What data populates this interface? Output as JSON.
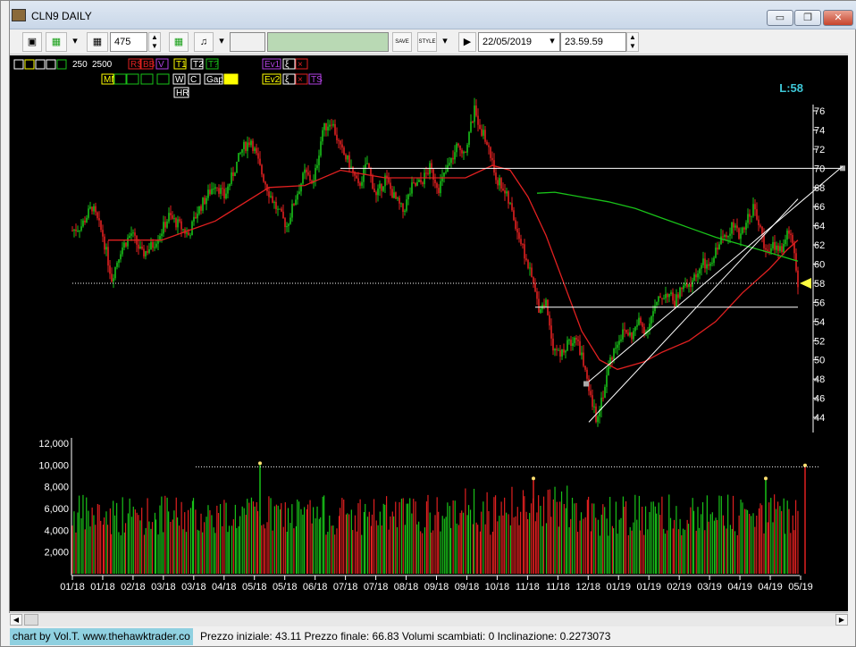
{
  "window": {
    "title": "CLN9 DAILY",
    "minimize_label": "▭",
    "restore_label": "❐",
    "close_label": "✕"
  },
  "toolbar": {
    "bars_value": "475",
    "date_value": "22/05/2019",
    "time_value": "23.59.59",
    "save_label": "SAVE",
    "style_label": "STYLE"
  },
  "indicator_bar": {
    "row1": [
      "250",
      "2500",
      "RS",
      "BB",
      "V",
      "T1",
      "T2",
      "T?",
      "Ev1",
      "ξ",
      "×"
    ],
    "row2": [
      "MM",
      "W",
      "C",
      "Gap",
      "Ev2",
      "ξ",
      "×",
      "TS"
    ],
    "row3": [
      "HR"
    ]
  },
  "last_label": "L:58",
  "colors": {
    "up": "#19c219",
    "down": "#e02020",
    "ma_fast": "#e02020",
    "ma_slow": "#19c219",
    "bg": "#000000",
    "credit_bg": "#8fd0e0"
  },
  "chart_data": {
    "type": "candlestick",
    "price_axis": {
      "ticks": [
        44,
        46,
        48,
        50,
        52,
        54,
        56,
        58,
        60,
        62,
        64,
        66,
        68,
        70,
        72,
        74,
        76
      ],
      "ylim": [
        43,
        77
      ]
    },
    "volume_axis": {
      "ticks": [
        "2,000",
        "4,000",
        "6,000",
        "8,000",
        "10,000",
        "12,000"
      ],
      "ylim": [
        0,
        12000
      ]
    },
    "x_labels": [
      "01/18",
      "01/18",
      "02/18",
      "03/18",
      "03/18",
      "04/18",
      "05/18",
      "05/18",
      "06/18",
      "07/18",
      "07/18",
      "08/18",
      "09/18",
      "09/18",
      "10/18",
      "11/18",
      "11/18",
      "12/18",
      "01/19",
      "01/19",
      "02/19",
      "03/19",
      "04/19",
      "04/19",
      "05/19"
    ],
    "close_path": [
      [
        0,
        63.5
      ],
      [
        10,
        64.0
      ],
      [
        22,
        66.0
      ],
      [
        34,
        63.0
      ],
      [
        44,
        58.5
      ],
      [
        54,
        61.5
      ],
      [
        66,
        63.2
      ],
      [
        78,
        61.0
      ],
      [
        90,
        62.0
      ],
      [
        100,
        63.5
      ],
      [
        108,
        65.0
      ],
      [
        120,
        64.0
      ],
      [
        130,
        63.0
      ],
      [
        140,
        65.5
      ],
      [
        150,
        67.0
      ],
      [
        160,
        68.5
      ],
      [
        170,
        67.0
      ],
      [
        180,
        69.5
      ],
      [
        190,
        72.0
      ],
      [
        200,
        73.0
      ],
      [
        210,
        70.0
      ],
      [
        220,
        67.5
      ],
      [
        230,
        65.5
      ],
      [
        240,
        64.0
      ],
      [
        250,
        67.0
      ],
      [
        260,
        69.5
      ],
      [
        270,
        68.5
      ],
      [
        280,
        74.0
      ],
      [
        290,
        75.0
      ],
      [
        300,
        72.0
      ],
      [
        310,
        70.5
      ],
      [
        320,
        68.0
      ],
      [
        330,
        70.5
      ],
      [
        340,
        67.0
      ],
      [
        350,
        69.0
      ],
      [
        360,
        67.0
      ],
      [
        370,
        65.5
      ],
      [
        380,
        68.0
      ],
      [
        390,
        68.5
      ],
      [
        400,
        70.0
      ],
      [
        410,
        68.0
      ],
      [
        420,
        70.0
      ],
      [
        430,
        72.0
      ],
      [
        440,
        72.0
      ],
      [
        450,
        76.0
      ],
      [
        458,
        74.0
      ],
      [
        466,
        72.0
      ],
      [
        474,
        69.0
      ],
      [
        482,
        68.0
      ],
      [
        490,
        66.0
      ],
      [
        498,
        63.5
      ],
      [
        506,
        61.0
      ],
      [
        514,
        58.5
      ],
      [
        522,
        55.5
      ],
      [
        530,
        56.0
      ],
      [
        538,
        51.5
      ],
      [
        546,
        50.5
      ],
      [
        554,
        51.5
      ],
      [
        562,
        52.5
      ],
      [
        570,
        50.5
      ],
      [
        578,
        46.5
      ],
      [
        586,
        44.0
      ],
      [
        594,
        46.5
      ],
      [
        602,
        50.0
      ],
      [
        610,
        52.0
      ],
      [
        618,
        53.0
      ],
      [
        626,
        52.5
      ],
      [
        634,
        54.0
      ],
      [
        642,
        53.0
      ],
      [
        650,
        55.0
      ],
      [
        658,
        56.5
      ],
      [
        666,
        57.0
      ],
      [
        674,
        56.0
      ],
      [
        682,
        57.5
      ],
      [
        690,
        57.5
      ],
      [
        698,
        59.0
      ],
      [
        706,
        60.0
      ],
      [
        714,
        59.5
      ],
      [
        722,
        62.0
      ],
      [
        730,
        63.0
      ],
      [
        738,
        64.0
      ],
      [
        746,
        63.0
      ],
      [
        754,
        64.5
      ],
      [
        762,
        66.0
      ],
      [
        770,
        63.5
      ],
      [
        778,
        61.0
      ],
      [
        786,
        62.0
      ],
      [
        794,
        61.5
      ],
      [
        802,
        63.5
      ],
      [
        808,
        61.5
      ],
      [
        812,
        58.0
      ]
    ],
    "series": [
      {
        "name": "",
        "kind": "moving-average",
        "color": "#e02020",
        "points": [
          [
            40,
            62.5
          ],
          [
            100,
            62.5
          ],
          [
            160,
            64.5
          ],
          [
            220,
            68.0
          ],
          [
            260,
            68.2
          ],
          [
            300,
            69.8
          ],
          [
            350,
            69.0
          ],
          [
            400,
            69.0
          ],
          [
            440,
            69.0
          ],
          [
            470,
            70.3
          ],
          [
            490,
            69.8
          ],
          [
            510,
            67.0
          ],
          [
            530,
            63.0
          ],
          [
            550,
            58.0
          ],
          [
            570,
            53.0
          ],
          [
            590,
            50.0
          ],
          [
            610,
            49.0
          ],
          [
            640,
            49.8
          ],
          [
            660,
            50.8
          ],
          [
            690,
            52.0
          ],
          [
            720,
            54.0
          ],
          [
            750,
            57.0
          ],
          [
            780,
            59.5
          ],
          [
            800,
            61.5
          ],
          [
            812,
            62.5
          ]
        ]
      },
      {
        "name": "",
        "kind": "moving-average",
        "color": "#19c219",
        "points": [
          [
            520,
            67.4
          ],
          [
            540,
            67.5
          ],
          [
            570,
            67.0
          ],
          [
            600,
            66.5
          ],
          [
            630,
            65.8
          ],
          [
            660,
            64.8
          ],
          [
            690,
            63.8
          ],
          [
            720,
            62.8
          ],
          [
            750,
            62.0
          ],
          [
            780,
            61.2
          ],
          [
            812,
            60.3
          ]
        ]
      }
    ],
    "volume": {
      "highlight_level": 10000,
      "recent_bar": 9800
    },
    "horizontal_lines": [
      70,
      58,
      55.5
    ],
    "channel": {
      "lower": [
        [
          575,
          47.5
        ],
        [
          862,
          70.2
        ]
      ],
      "upper_offset": 3.0
    }
  },
  "status": {
    "credit": "chart by Vol.T. www.thehawktrader.co",
    "stats": "Prezzo iniziale: 43.11 Prezzo finale: 66.83 Volumi scambiati: 0 Inclinazione: 0.2273073"
  }
}
